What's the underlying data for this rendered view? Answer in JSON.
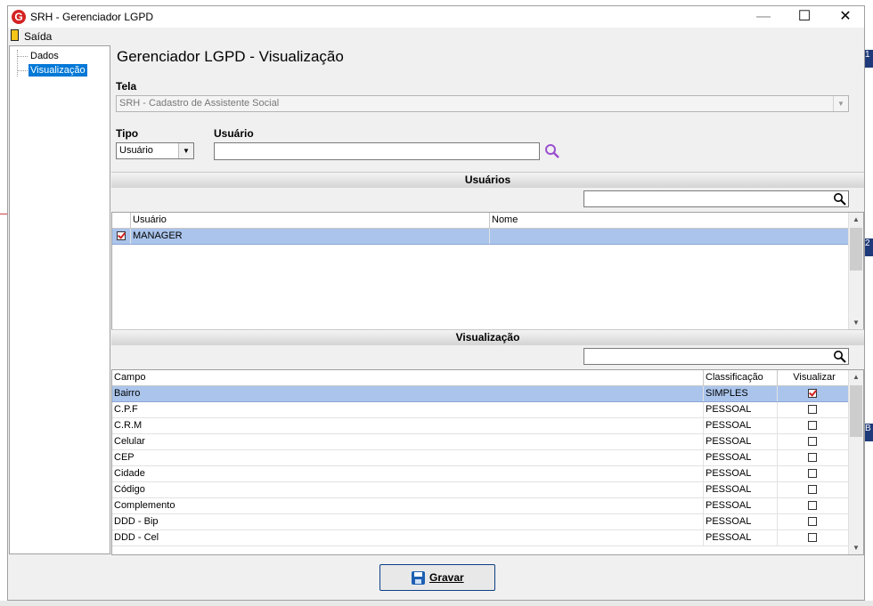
{
  "window": {
    "title": "SRH - Gerenciador LGPD",
    "icon_letter": "G"
  },
  "menu": {
    "exit_label": "Saída"
  },
  "tree": {
    "items": [
      {
        "label": "Dados"
      },
      {
        "label": "Visualização",
        "selected": true
      }
    ]
  },
  "form": {
    "title": "Gerenciador LGPD - Visualização",
    "tela_label": "Tela",
    "tela_value": "SRH - Cadastro de Assistente Social",
    "tipo_label": "Tipo",
    "tipo_value": "Usuário",
    "usuario_label": "Usuário",
    "usuario_value": ""
  },
  "usuarios_section": {
    "title": "Usuários",
    "columns": [
      "Usuário",
      "Nome"
    ],
    "rows": [
      {
        "checked": true,
        "usuario": "MANAGER",
        "nome": "",
        "selected": true
      }
    ]
  },
  "visualizacao_section": {
    "title": "Visualização",
    "columns": [
      "Campo",
      "Classificação",
      "Visualizar"
    ],
    "rows": [
      {
        "campo": "Bairro",
        "classificacao": "SIMPLES",
        "visualizar": true,
        "selected": true
      },
      {
        "campo": "C.P.F",
        "classificacao": "PESSOAL",
        "visualizar": false
      },
      {
        "campo": "C.R.M",
        "classificacao": "PESSOAL",
        "visualizar": false
      },
      {
        "campo": "Celular",
        "classificacao": "PESSOAL",
        "visualizar": false
      },
      {
        "campo": "CEP",
        "classificacao": "PESSOAL",
        "visualizar": false
      },
      {
        "campo": "Cidade",
        "classificacao": "PESSOAL",
        "visualizar": false
      },
      {
        "campo": "Código",
        "classificacao": "PESSOAL",
        "visualizar": false
      },
      {
        "campo": "Complemento",
        "classificacao": "PESSOAL",
        "visualizar": false
      },
      {
        "campo": "DDD - Bip",
        "classificacao": "PESSOAL",
        "visualizar": false
      },
      {
        "campo": "DDD - Cel",
        "classificacao": "PESSOAL",
        "visualizar": false
      }
    ]
  },
  "footer": {
    "save_label": "Gravar"
  },
  "background_tabs": [
    "1",
    "2",
    "B"
  ],
  "colors": {
    "selection": "#aac4ec",
    "tree_selection": "#0078d7",
    "accent": "#0b3f86"
  }
}
